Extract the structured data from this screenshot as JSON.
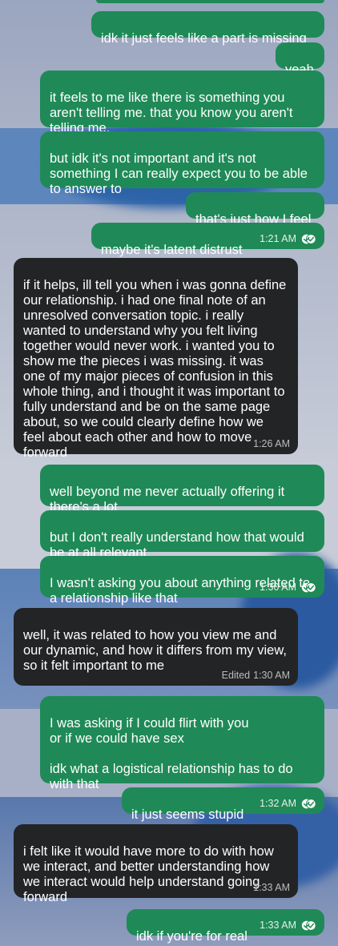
{
  "messages": [
    {
      "from": "me",
      "text": "idk it just feels like a part is missing"
    },
    {
      "from": "me",
      "text": "yeah"
    },
    {
      "from": "me",
      "text": "it feels to me like there is something you aren't telling me. that you know you aren't telling me."
    },
    {
      "from": "me",
      "text": "but idk it's not important and it's not something I can really expect you to be able to answer to"
    },
    {
      "from": "me",
      "text": "that's just how I feel"
    },
    {
      "from": "me",
      "text": "maybe it's latent distrust",
      "time": "1:21 AM"
    },
    {
      "from": "them",
      "text": "if it helps, ill tell you when i was gonna define our relationship. i had one final note of an unresolved conversation topic. i really wanted to understand why you felt living together would never work. i wanted you to show me the pieces i was missing. it was one of my major pieces of confusion in this whole thing, and i thought it was important to fully understand and be on the same page about, so we could clearly define how we feel about each other and how to move forward",
      "time": "1:26 AM"
    },
    {
      "from": "me",
      "text": "well beyond me never actually offering it there's a lot"
    },
    {
      "from": "me",
      "text": "but I don't really understand how that would be at all relevant"
    },
    {
      "from": "me",
      "text": "I wasn't asking you about anything related to a relationship like that",
      "time": "1:30 AM"
    },
    {
      "from": "them",
      "text": "well, it was related to how you view me and our dynamic, and how it differs from my view, so it felt important to me",
      "edited": "Edited",
      "time": "1:30 AM"
    },
    {
      "from": "me",
      "text": "I was asking if I could flirt with you\nor if we could have sex\n\nidk what a logistical relationship has to do with that"
    },
    {
      "from": "me",
      "text": "it just seems stupid",
      "time": "1:32 AM"
    },
    {
      "from": "them",
      "text": "i felt like it would have more to do with how we interact, and better understanding how we interact would help understand going forward",
      "time": "1:33 AM"
    },
    {
      "from": "me",
      "text": "idk if you're for real",
      "time": "1:33 AM"
    }
  ],
  "colors": {
    "outgoing": "#1f8a57",
    "incoming": "#232426",
    "read_check": "#ffffff"
  },
  "icons": {
    "read_receipt": "double-check-icon"
  }
}
